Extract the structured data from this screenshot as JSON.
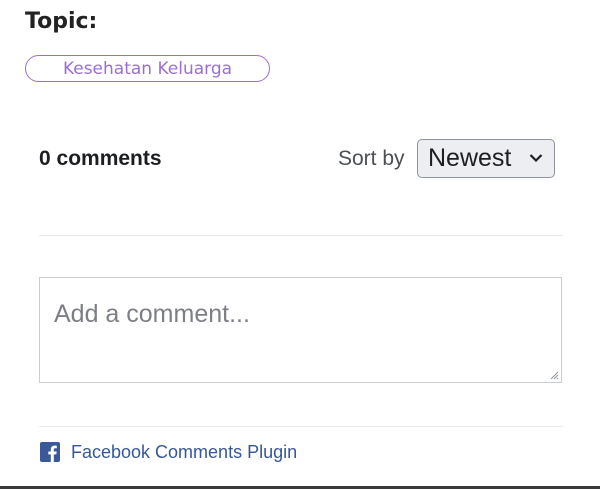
{
  "topic": {
    "label": "Topic:",
    "tag": "Kesehatan Keluarga"
  },
  "comments": {
    "count_label": "0 comments",
    "sort_label": "Sort by",
    "sort_selected": "Newest",
    "input_placeholder": "Add a comment..."
  },
  "footer": {
    "plugin_label": "Facebook Comments Plugin",
    "icon": "facebook-icon"
  },
  "colors": {
    "tag_accent": "#9b6fd1",
    "facebook_blue": "#365899",
    "facebook_icon": "#3b5998"
  }
}
